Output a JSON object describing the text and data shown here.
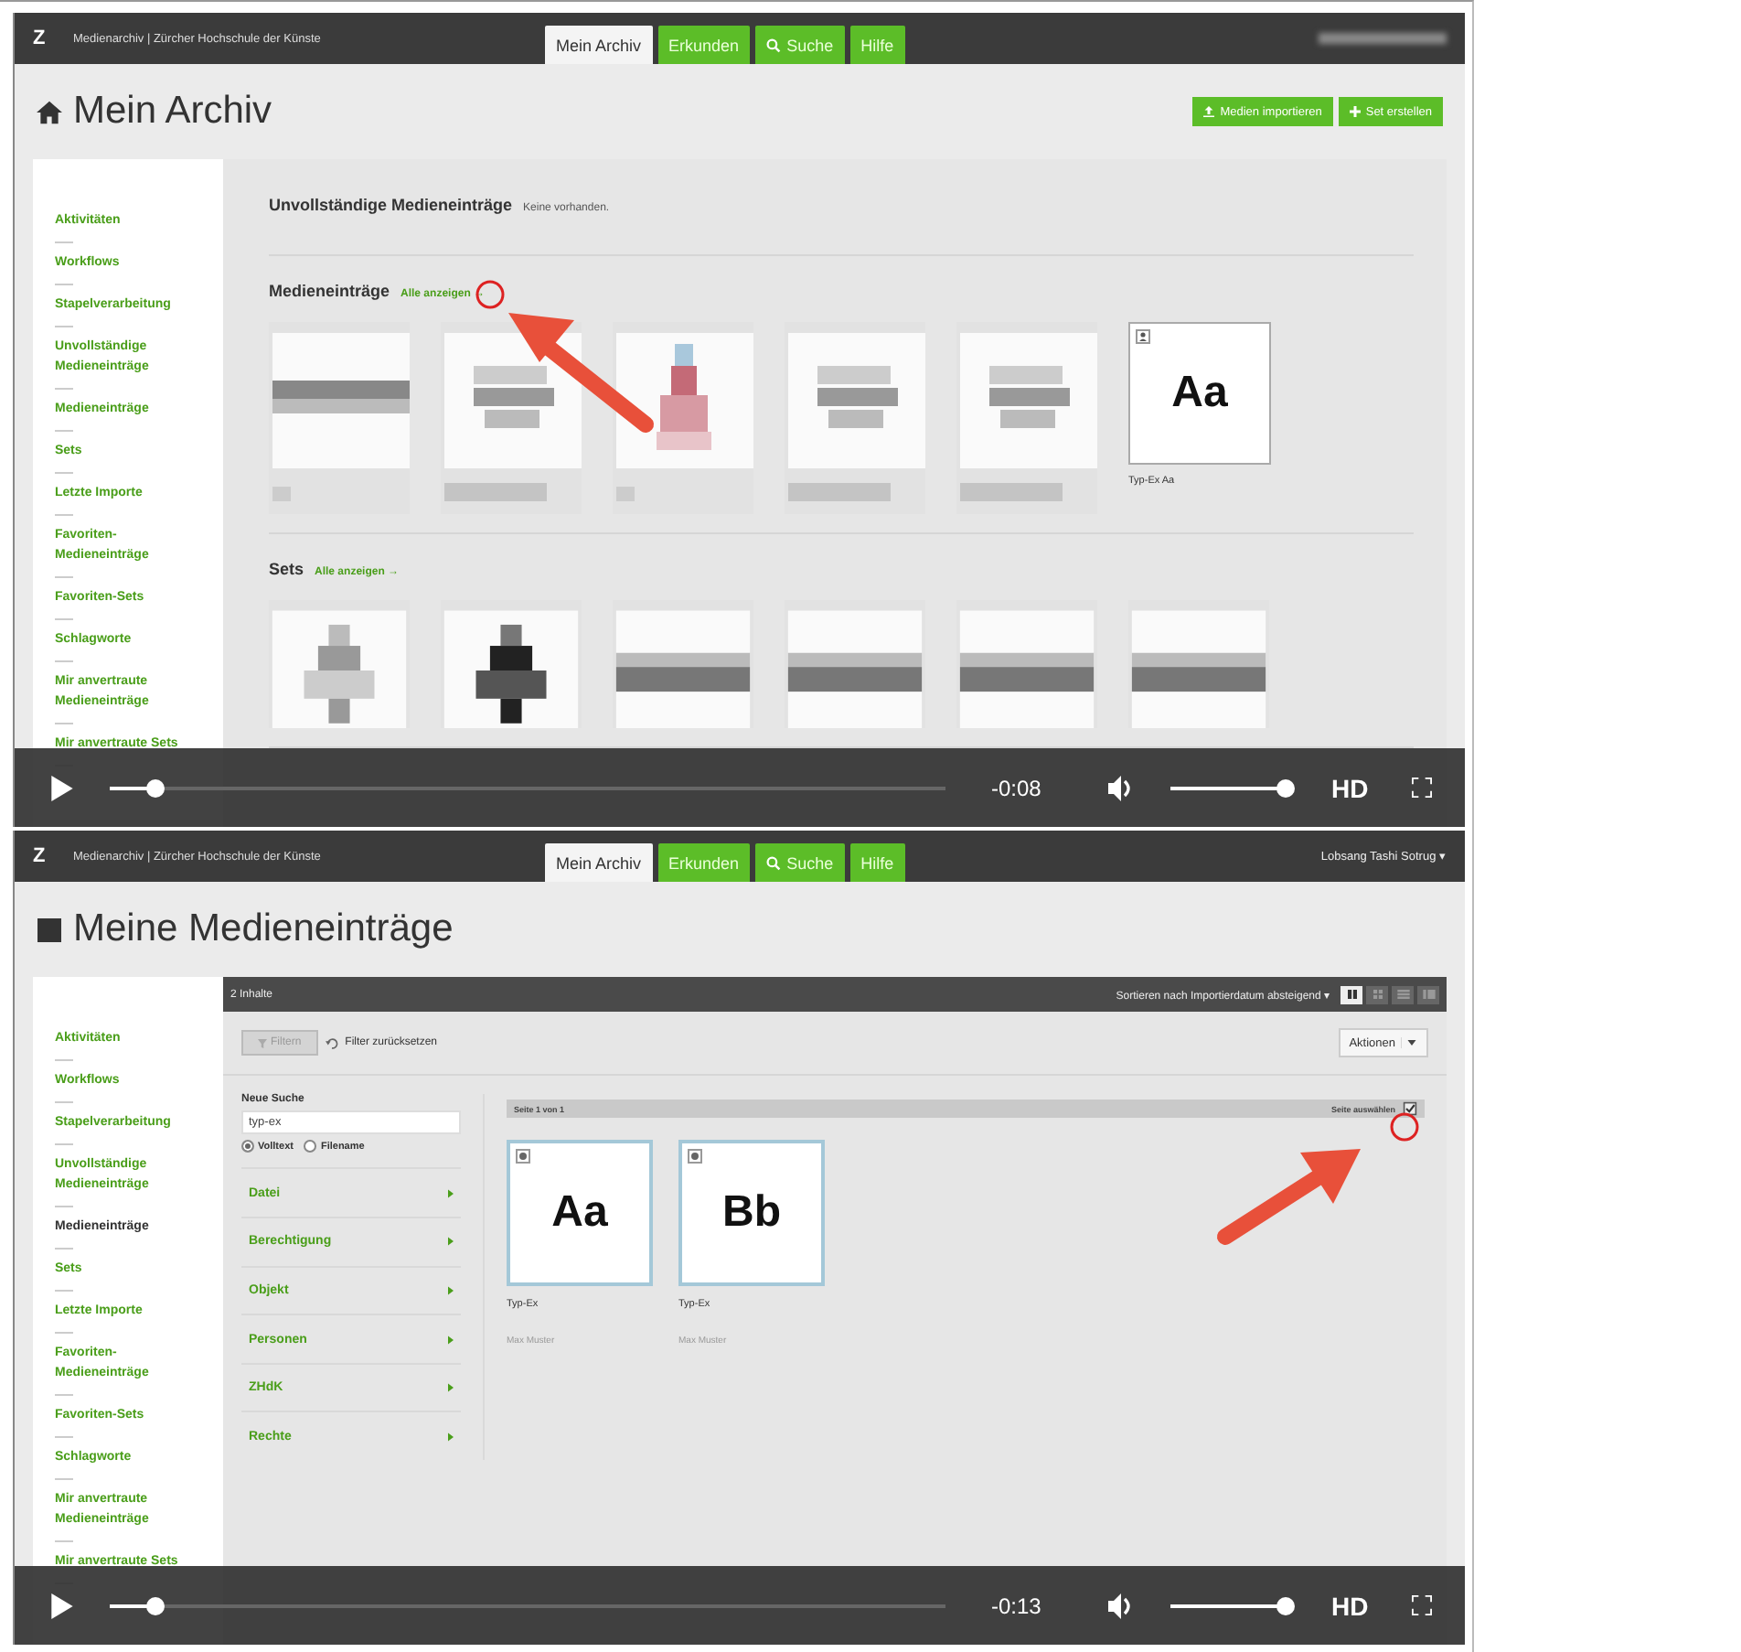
{
  "frames": [
    {
      "kind": "overview",
      "header": {
        "logo": "Z",
        "site": "Medienarchiv | Zürcher Hochschule der Künste",
        "tabs": [
          {
            "label": "Mein Archiv",
            "selected": true
          },
          {
            "label": "Erkunden",
            "selected": false
          },
          {
            "label": "Suche",
            "selected": false
          },
          {
            "label": "Hilfe",
            "selected": false
          }
        ]
      },
      "title": "Mein Archiv",
      "actions": [
        {
          "label": "Medien importieren"
        },
        {
          "label": "Set erstellen"
        }
      ],
      "sidebar": [
        {
          "label": "Aktivitäten",
          "selected": false
        },
        {
          "label": "Workflows",
          "selected": false
        },
        {
          "label": "Stapelverarbeitung",
          "selected": false
        },
        {
          "label": "Unvollständige Medieneinträge",
          "selected": false
        },
        {
          "label": "Medieneinträge",
          "selected": false
        },
        {
          "label": "Sets",
          "selected": false
        },
        {
          "label": "Letzte Importe",
          "selected": false
        },
        {
          "label": "Favoriten-Medieneinträge",
          "selected": false
        },
        {
          "label": "Favoriten-Sets",
          "selected": false
        },
        {
          "label": "Schlagworte",
          "selected": false
        },
        {
          "label": "Mir anvertraute Medieneinträge",
          "selected": false
        },
        {
          "label": "Mir anvertraute Sets",
          "selected": false
        }
      ],
      "sections": [
        {
          "title": "Unvollständige Medieneinträge",
          "note": "Keine vorhanden."
        },
        {
          "title": "Medieneinträge",
          "link": "Alle anzeigen →",
          "items": [
            {
              "kind": "picture"
            },
            {
              "kind": "picture"
            },
            {
              "kind": "picture"
            },
            {
              "kind": "picture"
            },
            {
              "kind": "picture"
            },
            {
              "kind": "text",
              "glyph": "Aa",
              "caption": "Typ-Ex Aa"
            }
          ]
        },
        {
          "title": "Sets",
          "link": "Alle anzeigen →",
          "items": [
            {
              "kind": "picture"
            },
            {
              "kind": "picture"
            },
            {
              "kind": "picture"
            },
            {
              "kind": "picture"
            },
            {
              "kind": "picture"
            },
            {
              "kind": "picture"
            }
          ]
        }
      ],
      "player": {
        "progress": {
          "level": 0.045
        },
        "time": "-0:08",
        "volume": {
          "level": 1
        },
        "quality": "HD"
      }
    },
    {
      "kind": "list",
      "header": {
        "logo": "Z",
        "site": "Medienarchiv | Zürcher Hochschule der Künste",
        "tabs": [
          {
            "label": "Mein Archiv",
            "selected": true
          },
          {
            "label": "Erkunden",
            "selected": false
          },
          {
            "label": "Suche",
            "selected": false
          },
          {
            "label": "Hilfe",
            "selected": false
          }
        ],
        "user": "Lobsang Tashi Sotrug ▾"
      },
      "title": "Meine Medieneinträge",
      "sidebar": [
        {
          "label": "Aktivitäten",
          "selected": false
        },
        {
          "label": "Workflows",
          "selected": false
        },
        {
          "label": "Stapelverarbeitung",
          "selected": false
        },
        {
          "label": "Unvollständige Medieneinträge",
          "selected": false
        },
        {
          "label": "Medieneinträge",
          "selected": true
        },
        {
          "label": "Sets",
          "selected": false
        },
        {
          "label": "Letzte Importe",
          "selected": false
        },
        {
          "label": "Favoriten-Medieneinträge",
          "selected": false
        },
        {
          "label": "Favoriten-Sets",
          "selected": false
        },
        {
          "label": "Schlagworte",
          "selected": false
        },
        {
          "label": "Mir anvertraute Medieneinträge",
          "selected": false
        },
        {
          "label": "Mir anvertraute Sets",
          "selected": false
        }
      ],
      "toolbar": {
        "count": "2 Inhalte",
        "sort": "Sortieren nach Importierdatum absteigend ▾",
        "views": [
          {
            "kind": "columns",
            "selected": true
          },
          {
            "kind": "grid",
            "selected": false
          },
          {
            "kind": "list",
            "selected": false
          },
          {
            "kind": "table",
            "selected": false
          }
        ]
      },
      "filter_button": {
        "label": "Filtern",
        "disabled": true
      },
      "reset": "Filter zurücksetzen",
      "actions_button": "Aktionen",
      "search": {
        "heading": "Neue Suche",
        "value": "typ-ex",
        "modes": [
          {
            "label": "Volltext",
            "selected": true
          },
          {
            "label": "Filename",
            "selected": false
          }
        ]
      },
      "facets": [
        "Datei",
        "Berechtigung",
        "Objekt",
        "Personen",
        "ZHdK",
        "Rechte"
      ],
      "pager": {
        "label": "Seite 1 von 1",
        "select": "Seite auswählen"
      },
      "items": [
        {
          "glyph": "Aa",
          "title": "Typ-Ex",
          "author": "Max Muster"
        },
        {
          "glyph": "Bb",
          "title": "Typ-Ex",
          "author": "Max Muster"
        }
      ],
      "player": {
        "progress": {
          "level": 0.045
        },
        "time": "-0:13",
        "volume": {
          "level": 1
        },
        "quality": "HD"
      }
    }
  ]
}
